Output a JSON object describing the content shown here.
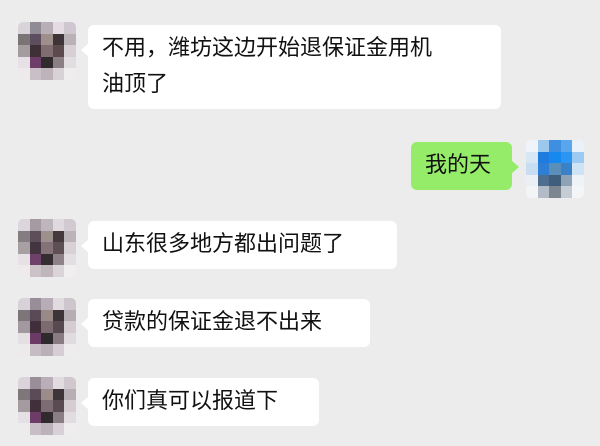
{
  "colors": {
    "background": "#ececec",
    "incoming_bubble": "#ffffff",
    "outgoing_bubble": "#95ec69",
    "text": "#111111"
  },
  "messages": [
    {
      "direction": "in",
      "lines": [
        "不用，潍坊这边开始退保证金用机",
        "油顶了"
      ]
    },
    {
      "direction": "out",
      "lines": [
        "我的天"
      ]
    },
    {
      "direction": "in",
      "lines": [
        "山东很多地方都出问题了"
      ]
    },
    {
      "direction": "in",
      "lines": [
        "贷款的保证金退不出来"
      ]
    },
    {
      "direction": "in",
      "lines": [
        "你们真可以报道下"
      ]
    }
  ]
}
